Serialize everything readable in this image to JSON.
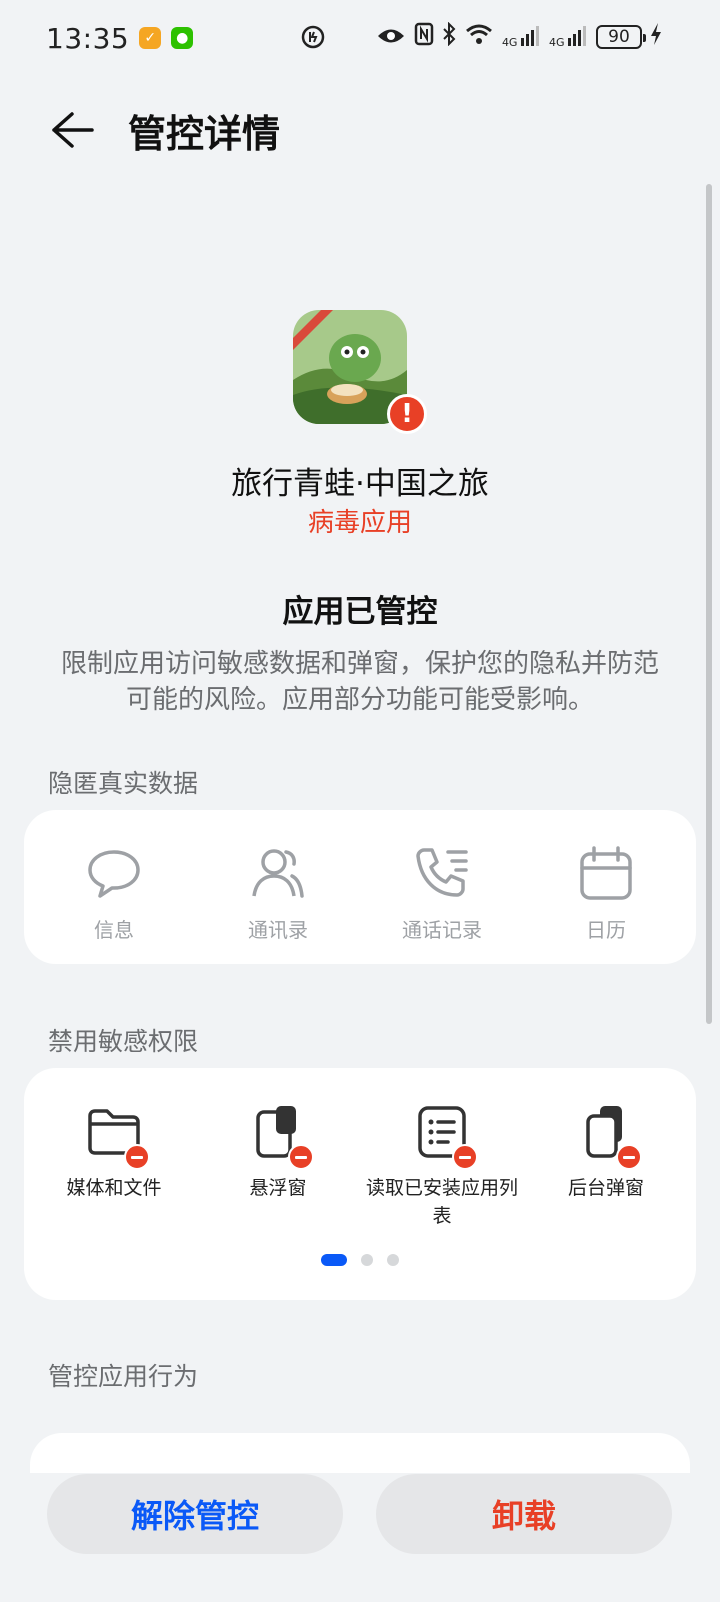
{
  "status_bar": {
    "time": "13:35",
    "battery": "90",
    "signal1": "4G",
    "signal2": "4G"
  },
  "header": {
    "back_icon": "arrow-left-icon",
    "title": "管控详情"
  },
  "app": {
    "name": "旅行青蛙·中国之旅",
    "tag": "病毒应用",
    "tag_color": "#e84026"
  },
  "control_status": {
    "heading": "应用已管控",
    "description": "限制应用访问敏感数据和弹窗，保护您的隐私并防范可能的风险。应用部分功能可能受影响。"
  },
  "hide_data": {
    "title": "隐匿真实数据",
    "items": [
      {
        "label": "信息",
        "icon": "message-icon"
      },
      {
        "label": "通讯录",
        "icon": "contacts-icon"
      },
      {
        "label": "通话记录",
        "icon": "call-log-icon"
      },
      {
        "label": "日历",
        "icon": "calendar-icon"
      }
    ]
  },
  "disabled_permissions": {
    "title": "禁用敏感权限",
    "items": [
      {
        "label": "媒体和文件",
        "icon": "folder-icon"
      },
      {
        "label": "悬浮窗",
        "icon": "floating-window-icon"
      },
      {
        "label": "读取已安装应用列表",
        "icon": "app-list-icon"
      },
      {
        "label": "后台弹窗",
        "icon": "background-popup-icon"
      }
    ],
    "page_count": 3,
    "active_page": 1
  },
  "behavior": {
    "title": "管控应用行为"
  },
  "actions": {
    "release_label": "解除管控",
    "uninstall_label": "卸载",
    "accent": "#0a59f7",
    "danger": "#e84026"
  }
}
